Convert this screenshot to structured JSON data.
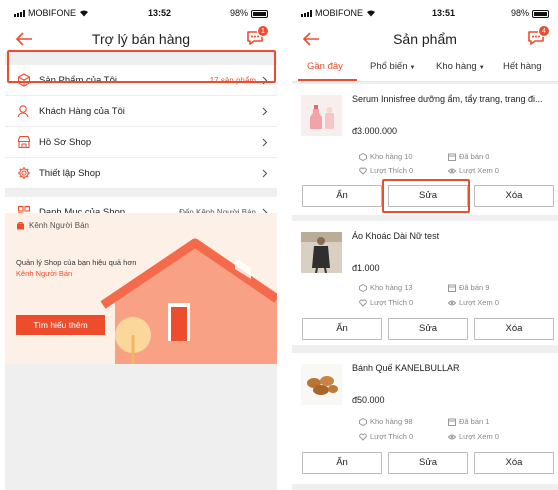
{
  "left": {
    "status": {
      "carrier": "MOBIFONE",
      "time": "13:52",
      "battery": "98%"
    },
    "header": {
      "title": "Trợ lý bán hàng",
      "chat_badge": "1"
    },
    "menu": [
      {
        "label": "Sản Phẩm của Tôi",
        "right": "17 sản phẩm",
        "icon": "box-icon"
      },
      {
        "label": "Khách Hàng của Tôi",
        "right": "",
        "icon": "customer-icon"
      },
      {
        "label": "Hồ Sơ Shop",
        "right": "",
        "icon": "shop-icon"
      },
      {
        "label": "Thiết lập Shop",
        "right": "",
        "icon": "gear-icon"
      }
    ],
    "category": {
      "label": "Danh Mục của Shop",
      "right": "Đến Kênh Người Bán"
    },
    "banner": {
      "title": "Kênh Người Bán",
      "desc": "Quản lý Shop của bạn hiệu quả hơn",
      "link": "Kênh Người Bán",
      "button": "Tìm hiểu thêm"
    }
  },
  "right": {
    "status": {
      "carrier": "MOBIFONE",
      "time": "13:51",
      "battery": "98%"
    },
    "header": {
      "title": "Sản phẩm",
      "chat_badge": "4"
    },
    "tabs": [
      "Gần đây",
      "Phổ biến",
      "Kho hàng",
      "Hết hàng"
    ],
    "products": [
      {
        "name": "Serum Innisfree dưỡng ẩm, tẩy trang, trang đi...",
        "price": "đ3.000.000",
        "stock": "Kho hàng 10",
        "sold": "Đã bán 0",
        "likes": "Lượt Thích 0",
        "views": "Lượt Xem 0"
      },
      {
        "name": "Áo Khoác Dài Nữ test",
        "price": "đ1.000",
        "stock": "Kho hàng 13",
        "sold": "Đã bán 9",
        "likes": "Lượt Thích 0",
        "views": "Lượt Xem 0"
      },
      {
        "name": "Bánh Quế  KANELBULLAR",
        "price": "đ50.000",
        "stock": "Kho hàng 98",
        "sold": "Đã bán 1",
        "likes": "Lượt Thích 0",
        "views": "Lượt Xem 0"
      }
    ],
    "actions": {
      "hide": "Ẩn",
      "edit": "Sửa",
      "delete": "Xóa"
    }
  },
  "colors": {
    "accent": "#ee4d2d",
    "background": "#efefef"
  }
}
